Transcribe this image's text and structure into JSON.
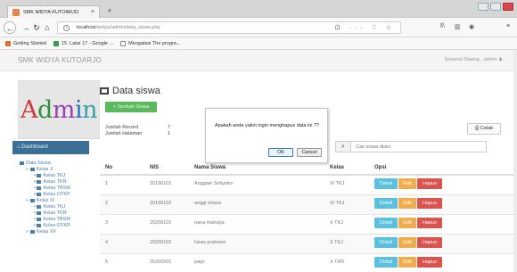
{
  "browser": {
    "tab_title": "SMK WIDYA KUTOARJO",
    "tab_close": "×",
    "new_tab": "+",
    "url_host": "localhost",
    "url_path": "/widya/admin/data_siswa.php",
    "url_icons": "⊡ ··· ♡ ☆",
    "nav_right_1": "‖\\",
    "nav_right_2": "▥",
    "nav_right_3": "◉",
    "nav_right_4": "≡",
    "bookmarks": [
      "Getting Started",
      "15. Latar 17 - Google ...",
      "Mengatasi The progra..."
    ]
  },
  "header": {
    "brand": "SMK WIDYA KUTOARJO",
    "user": "Selamat Datang , admin"
  },
  "sidebar": {
    "logo_text": "Admin",
    "dashboard_label": "Dashboard",
    "tree": [
      {
        "label": "Data Siswa",
        "level": 0
      },
      {
        "label": "Kelas X",
        "level": 1
      },
      {
        "label": "Kelas TKJ",
        "level": 2
      },
      {
        "label": "Kelas TKR",
        "level": 2
      },
      {
        "label": "Kelas TBSM",
        "level": 2
      },
      {
        "label": "Kelas OTKP",
        "level": 2
      },
      {
        "label": "Kelas XI",
        "level": 1
      },
      {
        "label": "Kelas TKJ",
        "level": 2
      },
      {
        "label": "Kelas TKR",
        "level": 2
      },
      {
        "label": "Kelas TBSM",
        "level": 2
      },
      {
        "label": "Kelas OTKP",
        "level": 2
      },
      {
        "label": "Kelas XII",
        "level": 1
      }
    ]
  },
  "main": {
    "title": "Data siswa",
    "add_button": "Tambah Siswa",
    "record_label": "Jumlah Record",
    "record_value": "7",
    "page_label": "Jumlah Halaman",
    "page_value": "1",
    "print_button": "Cetak",
    "search_placeholder": "Cari siswa disini",
    "columns": [
      "No",
      "NIS",
      "Nama Siswa",
      "Kelas",
      "Opsi"
    ],
    "rows": [
      {
        "no": "1",
        "nis": "20190101",
        "nama": "Anggian Setiyoko",
        "kelas": "XI TKJ"
      },
      {
        "no": "2",
        "nis": "20190102",
        "nama": "anggi intana",
        "kelas": "XI TKJ"
      },
      {
        "no": "3",
        "nis": "20200101",
        "nama": "nana maharja",
        "kelas": "X TKJ"
      },
      {
        "no": "4",
        "nis": "20200102",
        "nama": "lukas prabowo",
        "kelas": "X TKJ"
      },
      {
        "no": "5",
        "nis": "20200201",
        "nama": "paijo",
        "kelas": "X TKR"
      }
    ],
    "action_detail": "Detail",
    "action_edit": "Edit",
    "action_hapus": "Hapus"
  },
  "dialog": {
    "message": "Apakah anda yakin ingin menghapus data ini ??",
    "ok": "OK",
    "cancel": "Cancel"
  },
  "colors": {
    "logo_letters": [
      "#cc3a3a",
      "#2f8f3a",
      "#9b3fb0",
      "#2f6fbf",
      "#3aa0a8"
    ]
  }
}
